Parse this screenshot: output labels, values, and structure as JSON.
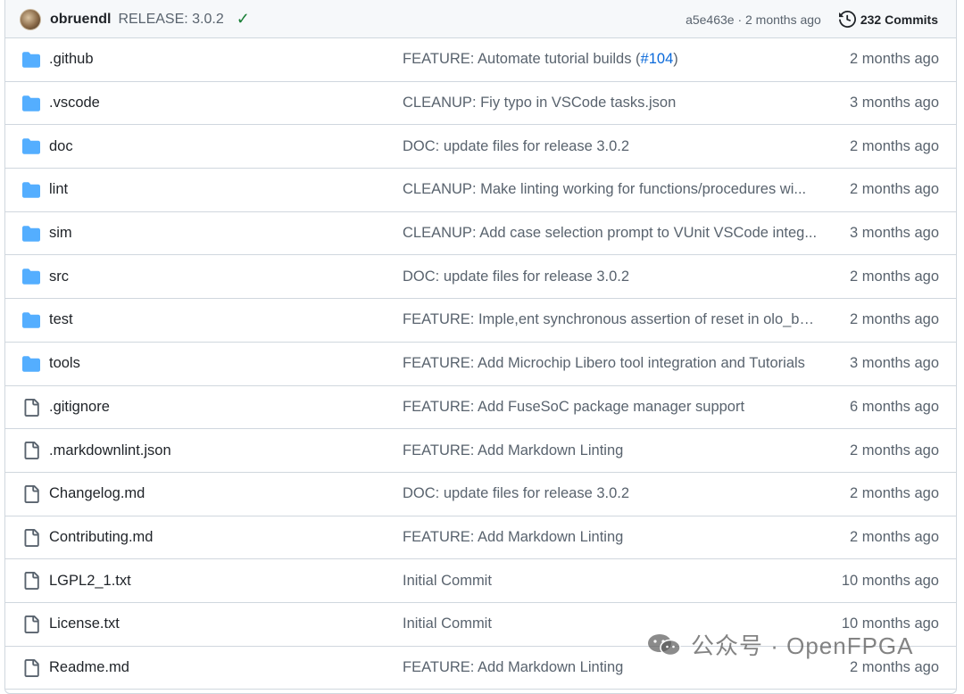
{
  "header": {
    "author": "obruendl",
    "message": "RELEASE: 3.0.2",
    "commit_meta": "a5e463e · 2 months ago",
    "commits_label": "232 Commits",
    "status_color": "#1a7f37"
  },
  "files": [
    {
      "type": "folder",
      "name": ".github",
      "message_prefix": "FEATURE: Automate tutorial builds (",
      "issue": "#104",
      "message_suffix": ")",
      "time": "2 months ago"
    },
    {
      "type": "folder",
      "name": ".vscode",
      "message_prefix": "CLEANUP: Fiy typo in VSCode tasks.json",
      "issue": "",
      "message_suffix": "",
      "time": "3 months ago"
    },
    {
      "type": "folder",
      "name": "doc",
      "message_prefix": "DOC: update files for release 3.0.2",
      "issue": "",
      "message_suffix": "",
      "time": "2 months ago"
    },
    {
      "type": "folder",
      "name": "lint",
      "message_prefix": "CLEANUP: Make linting working for functions/procedures wi...",
      "issue": "",
      "message_suffix": "",
      "time": "2 months ago"
    },
    {
      "type": "folder",
      "name": "sim",
      "message_prefix": "CLEANUP: Add case selection prompt to VUnit VSCode integ...",
      "issue": "",
      "message_suffix": "",
      "time": "3 months ago"
    },
    {
      "type": "folder",
      "name": "src",
      "message_prefix": "DOC: update files for release 3.0.2",
      "issue": "",
      "message_suffix": "",
      "time": "2 months ago"
    },
    {
      "type": "folder",
      "name": "test",
      "message_prefix": "FEATURE: Imple,ent synchronous assertion of reset in olo_ba...",
      "issue": "",
      "message_suffix": "",
      "time": "2 months ago"
    },
    {
      "type": "folder",
      "name": "tools",
      "message_prefix": "FEATURE: Add Microchip Libero tool integration and Tutorials",
      "issue": "",
      "message_suffix": "",
      "time": "3 months ago"
    },
    {
      "type": "file",
      "name": ".gitignore",
      "message_prefix": "FEATURE: Add FuseSoC package manager support",
      "issue": "",
      "message_suffix": "",
      "time": "6 months ago"
    },
    {
      "type": "file",
      "name": ".markdownlint.json",
      "message_prefix": "FEATURE: Add Markdown Linting",
      "issue": "",
      "message_suffix": "",
      "time": "2 months ago"
    },
    {
      "type": "file",
      "name": "Changelog.md",
      "message_prefix": "DOC: update files for release 3.0.2",
      "issue": "",
      "message_suffix": "",
      "time": "2 months ago"
    },
    {
      "type": "file",
      "name": "Contributing.md",
      "message_prefix": "FEATURE: Add Markdown Linting",
      "issue": "",
      "message_suffix": "",
      "time": "2 months ago"
    },
    {
      "type": "file",
      "name": "LGPL2_1.txt",
      "message_prefix": "Initial Commit",
      "issue": "",
      "message_suffix": "",
      "time": "10 months ago"
    },
    {
      "type": "file",
      "name": "License.txt",
      "message_prefix": "Initial Commit",
      "issue": "",
      "message_suffix": "",
      "time": "10 months ago"
    },
    {
      "type": "file",
      "name": "Readme.md",
      "message_prefix": "FEATURE: Add Markdown Linting",
      "issue": "",
      "message_suffix": "",
      "time": "2 months ago"
    }
  ],
  "watermark": {
    "text": "公众号 · OpenFPGA"
  },
  "colors": {
    "folder": "#54aeff",
    "link": "#0969da",
    "muted": "#59636e",
    "border": "#d0d7de"
  }
}
